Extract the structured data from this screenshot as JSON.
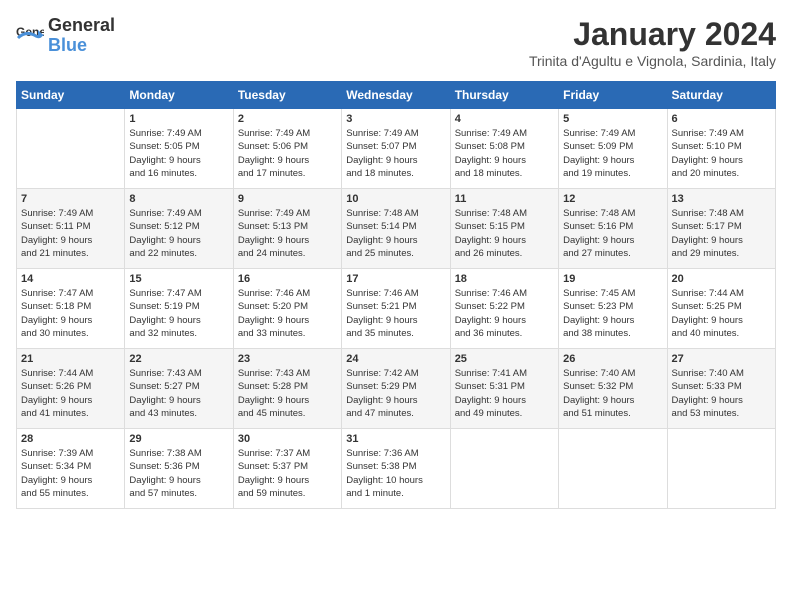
{
  "header": {
    "logo_general": "General",
    "logo_blue": "Blue",
    "month": "January 2024",
    "location": "Trinita d'Agultu e Vignola, Sardinia, Italy"
  },
  "weekdays": [
    "Sunday",
    "Monday",
    "Tuesday",
    "Wednesday",
    "Thursday",
    "Friday",
    "Saturday"
  ],
  "weeks": [
    [
      {
        "day": "",
        "info": ""
      },
      {
        "day": "1",
        "info": "Sunrise: 7:49 AM\nSunset: 5:05 PM\nDaylight: 9 hours\nand 16 minutes."
      },
      {
        "day": "2",
        "info": "Sunrise: 7:49 AM\nSunset: 5:06 PM\nDaylight: 9 hours\nand 17 minutes."
      },
      {
        "day": "3",
        "info": "Sunrise: 7:49 AM\nSunset: 5:07 PM\nDaylight: 9 hours\nand 18 minutes."
      },
      {
        "day": "4",
        "info": "Sunrise: 7:49 AM\nSunset: 5:08 PM\nDaylight: 9 hours\nand 18 minutes."
      },
      {
        "day": "5",
        "info": "Sunrise: 7:49 AM\nSunset: 5:09 PM\nDaylight: 9 hours\nand 19 minutes."
      },
      {
        "day": "6",
        "info": "Sunrise: 7:49 AM\nSunset: 5:10 PM\nDaylight: 9 hours\nand 20 minutes."
      }
    ],
    [
      {
        "day": "7",
        "info": "Sunrise: 7:49 AM\nSunset: 5:11 PM\nDaylight: 9 hours\nand 21 minutes."
      },
      {
        "day": "8",
        "info": "Sunrise: 7:49 AM\nSunset: 5:12 PM\nDaylight: 9 hours\nand 22 minutes."
      },
      {
        "day": "9",
        "info": "Sunrise: 7:49 AM\nSunset: 5:13 PM\nDaylight: 9 hours\nand 24 minutes."
      },
      {
        "day": "10",
        "info": "Sunrise: 7:48 AM\nSunset: 5:14 PM\nDaylight: 9 hours\nand 25 minutes."
      },
      {
        "day": "11",
        "info": "Sunrise: 7:48 AM\nSunset: 5:15 PM\nDaylight: 9 hours\nand 26 minutes."
      },
      {
        "day": "12",
        "info": "Sunrise: 7:48 AM\nSunset: 5:16 PM\nDaylight: 9 hours\nand 27 minutes."
      },
      {
        "day": "13",
        "info": "Sunrise: 7:48 AM\nSunset: 5:17 PM\nDaylight: 9 hours\nand 29 minutes."
      }
    ],
    [
      {
        "day": "14",
        "info": "Sunrise: 7:47 AM\nSunset: 5:18 PM\nDaylight: 9 hours\nand 30 minutes."
      },
      {
        "day": "15",
        "info": "Sunrise: 7:47 AM\nSunset: 5:19 PM\nDaylight: 9 hours\nand 32 minutes."
      },
      {
        "day": "16",
        "info": "Sunrise: 7:46 AM\nSunset: 5:20 PM\nDaylight: 9 hours\nand 33 minutes."
      },
      {
        "day": "17",
        "info": "Sunrise: 7:46 AM\nSunset: 5:21 PM\nDaylight: 9 hours\nand 35 minutes."
      },
      {
        "day": "18",
        "info": "Sunrise: 7:46 AM\nSunset: 5:22 PM\nDaylight: 9 hours\nand 36 minutes."
      },
      {
        "day": "19",
        "info": "Sunrise: 7:45 AM\nSunset: 5:23 PM\nDaylight: 9 hours\nand 38 minutes."
      },
      {
        "day": "20",
        "info": "Sunrise: 7:44 AM\nSunset: 5:25 PM\nDaylight: 9 hours\nand 40 minutes."
      }
    ],
    [
      {
        "day": "21",
        "info": "Sunrise: 7:44 AM\nSunset: 5:26 PM\nDaylight: 9 hours\nand 41 minutes."
      },
      {
        "day": "22",
        "info": "Sunrise: 7:43 AM\nSunset: 5:27 PM\nDaylight: 9 hours\nand 43 minutes."
      },
      {
        "day": "23",
        "info": "Sunrise: 7:43 AM\nSunset: 5:28 PM\nDaylight: 9 hours\nand 45 minutes."
      },
      {
        "day": "24",
        "info": "Sunrise: 7:42 AM\nSunset: 5:29 PM\nDaylight: 9 hours\nand 47 minutes."
      },
      {
        "day": "25",
        "info": "Sunrise: 7:41 AM\nSunset: 5:31 PM\nDaylight: 9 hours\nand 49 minutes."
      },
      {
        "day": "26",
        "info": "Sunrise: 7:40 AM\nSunset: 5:32 PM\nDaylight: 9 hours\nand 51 minutes."
      },
      {
        "day": "27",
        "info": "Sunrise: 7:40 AM\nSunset: 5:33 PM\nDaylight: 9 hours\nand 53 minutes."
      }
    ],
    [
      {
        "day": "28",
        "info": "Sunrise: 7:39 AM\nSunset: 5:34 PM\nDaylight: 9 hours\nand 55 minutes."
      },
      {
        "day": "29",
        "info": "Sunrise: 7:38 AM\nSunset: 5:36 PM\nDaylight: 9 hours\nand 57 minutes."
      },
      {
        "day": "30",
        "info": "Sunrise: 7:37 AM\nSunset: 5:37 PM\nDaylight: 9 hours\nand 59 minutes."
      },
      {
        "day": "31",
        "info": "Sunrise: 7:36 AM\nSunset: 5:38 PM\nDaylight: 10 hours\nand 1 minute."
      },
      {
        "day": "",
        "info": ""
      },
      {
        "day": "",
        "info": ""
      },
      {
        "day": "",
        "info": ""
      }
    ]
  ]
}
